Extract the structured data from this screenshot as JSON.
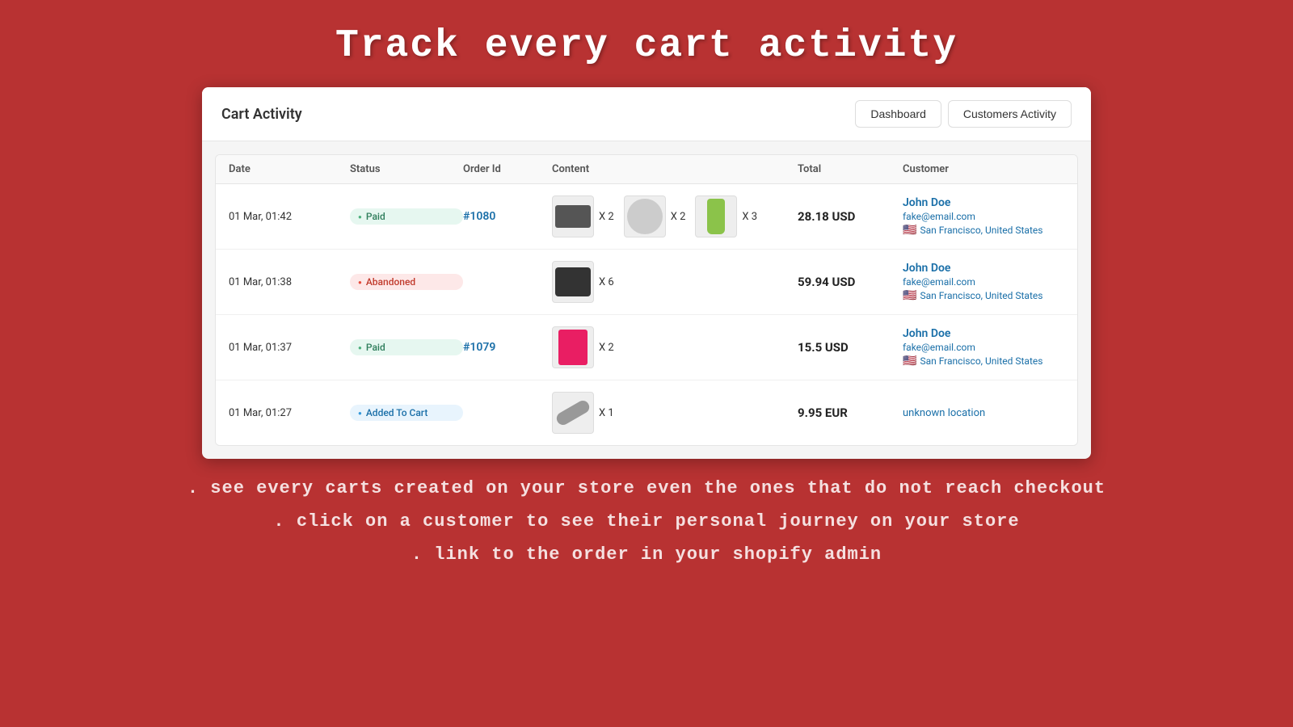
{
  "page": {
    "title": "Track every cart activity",
    "subtitle1": ". see every carts created on your store even the ones that do not reach checkout",
    "subtitle2": ". click on a customer to see their personal journey on your store",
    "subtitle3": ". link to the order in your shopify admin"
  },
  "header": {
    "app_title": "Cart Activity",
    "btn_dashboard": "Dashboard",
    "btn_customers": "Customers Activity"
  },
  "table": {
    "columns": [
      "Date",
      "Status",
      "Order Id",
      "Content",
      "Total",
      "Customer"
    ],
    "rows": [
      {
        "date": "01 Mar, 01:42",
        "status": "Paid",
        "status_type": "paid",
        "order_id": "#1080",
        "products": [
          {
            "icon": "dark-rect",
            "qty": "X 2"
          },
          {
            "icon": "tool",
            "qty": "X 2"
          },
          {
            "icon": "bottle",
            "qty": "X 3"
          }
        ],
        "total": "28.18 USD",
        "customer_name": "John Doe",
        "customer_email": "fake@email.com",
        "customer_location": "San Francisco, United States",
        "has_flag": true
      },
      {
        "date": "01 Mar, 01:38",
        "status": "Abandoned",
        "status_type": "abandoned",
        "order_id": "",
        "products": [
          {
            "icon": "camera",
            "qty": "X 6"
          }
        ],
        "total": "59.94 USD",
        "customer_name": "John Doe",
        "customer_email": "fake@email.com",
        "customer_location": "San Francisco, United States",
        "has_flag": true
      },
      {
        "date": "01 Mar, 01:37",
        "status": "Paid",
        "status_type": "paid",
        "order_id": "#1079",
        "products": [
          {
            "icon": "card",
            "qty": "X 2"
          }
        ],
        "total": "15.5 USD",
        "customer_name": "John Doe",
        "customer_email": "fake@email.com",
        "customer_location": "San Francisco, United States",
        "has_flag": true
      },
      {
        "date": "01 Mar, 01:27",
        "status": "Added To Cart",
        "status_type": "added",
        "order_id": "",
        "products": [
          {
            "icon": "thin-tool",
            "qty": "X 1"
          }
        ],
        "total": "9.95 EUR",
        "customer_name": "",
        "customer_email": "",
        "customer_location": "unknown location",
        "has_flag": false
      }
    ]
  }
}
